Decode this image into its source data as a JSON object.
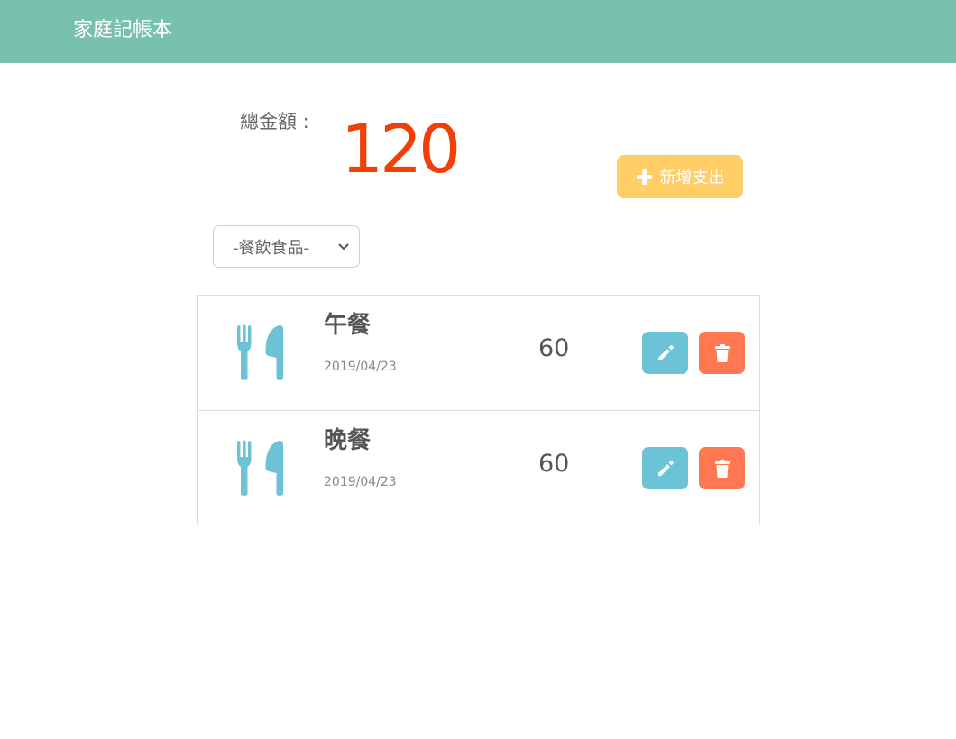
{
  "navbar": {
    "brand": "家庭記帳本"
  },
  "summary": {
    "total_label": "總金額 :",
    "total_amount": "120"
  },
  "toolbar": {
    "add_label": "新增支出"
  },
  "filter": {
    "selected": "-餐飲食品-"
  },
  "expenses": [
    {
      "title": "午餐",
      "date": "2019/04/23",
      "amount": "60",
      "category_icon": "utensils-icon"
    },
    {
      "title": "晚餐",
      "date": "2019/04/23",
      "amount": "60",
      "category_icon": "utensils-icon"
    }
  ],
  "colors": {
    "navbar": "#78c2ad",
    "total_amount": "#f13f09",
    "add_button": "#ffce67",
    "category_icon": "#6cc3d5",
    "edit_button": "#6cc3d5",
    "delete_button": "#ff7851"
  }
}
